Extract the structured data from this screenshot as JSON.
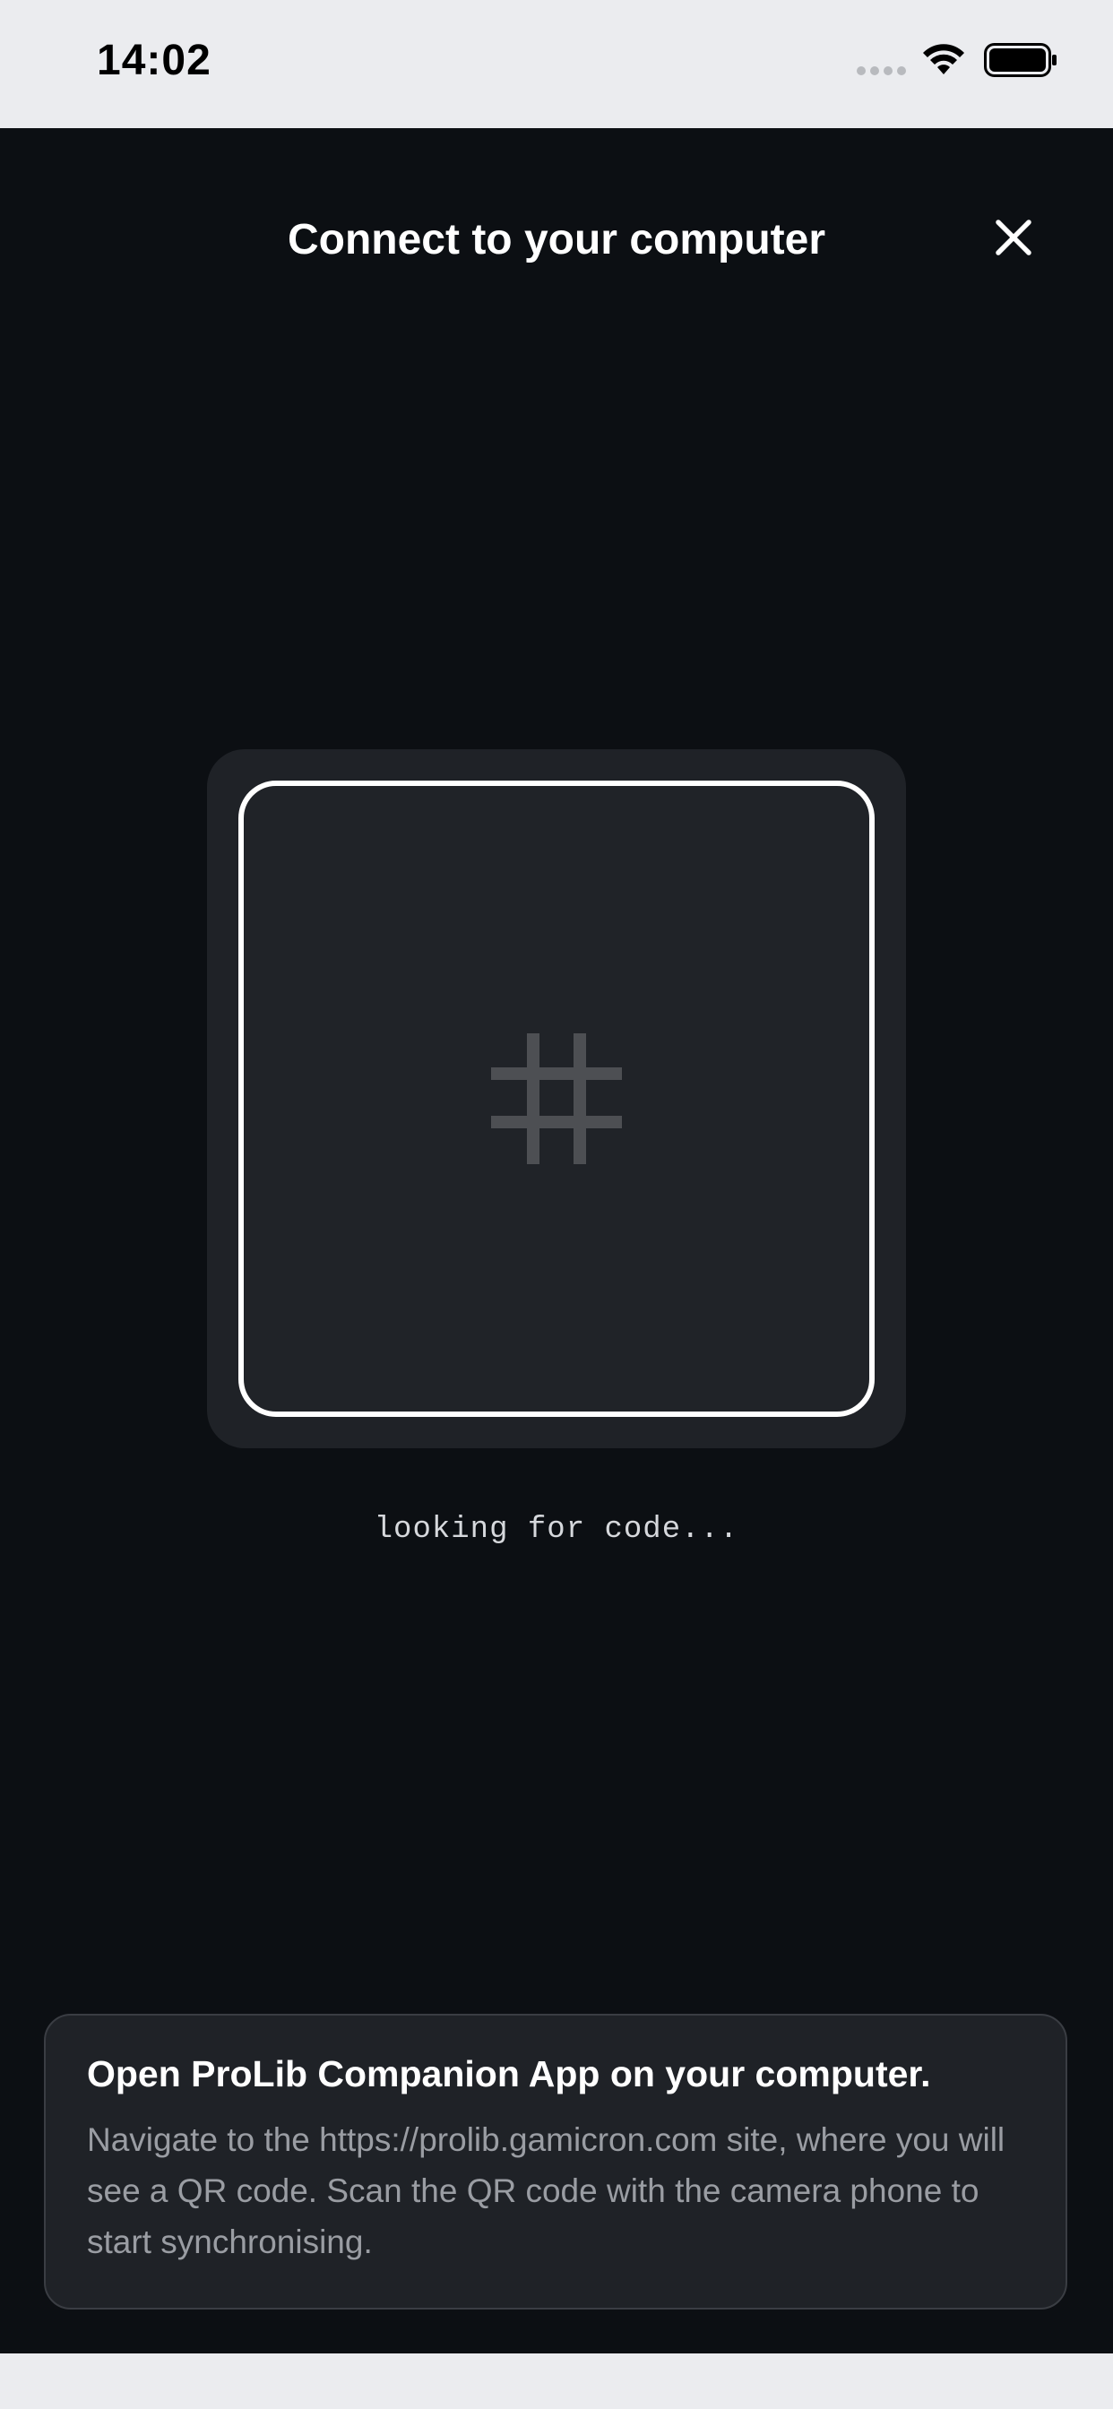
{
  "status_bar": {
    "time": "14:02"
  },
  "header": {
    "title": "Connect to your computer",
    "close_icon": "close-icon"
  },
  "scanner": {
    "icon": "hash-icon",
    "status": "looking for code..."
  },
  "info_card": {
    "title": "Open ProLib Companion App on your computer.",
    "body": "Navigate to the https://prolib.gamicron.com site, where you will see a QR code. Scan the QR code with the camera phone to start synchronising."
  },
  "colors": {
    "background": "#0c0f13",
    "card": "#1f2227",
    "system_bar": "#ebecef",
    "text_primary": "#ffffff",
    "text_secondary": "#9a9da3"
  }
}
